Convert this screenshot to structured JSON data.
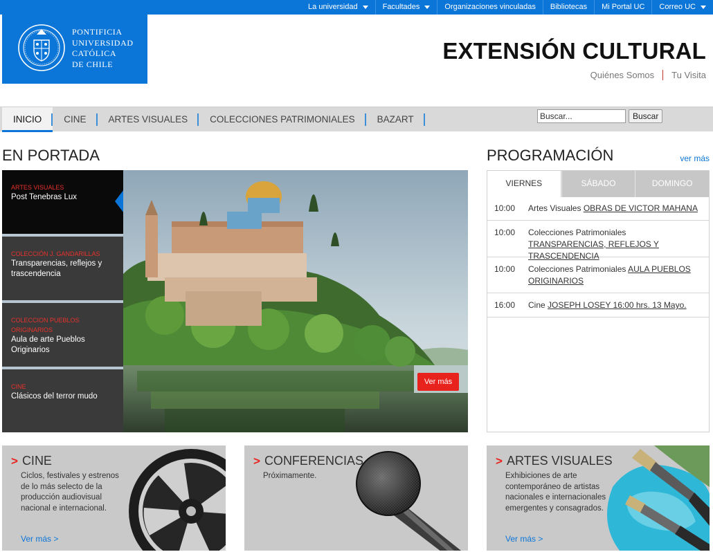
{
  "topnav": [
    {
      "label": "La universidad",
      "dropdown": true
    },
    {
      "label": "Facultades",
      "dropdown": true
    },
    {
      "label": "Organizaciones vinculadas",
      "dropdown": false
    },
    {
      "label": "Bibliotecas",
      "dropdown": false
    },
    {
      "label": "Mi Portal UC",
      "dropdown": false
    },
    {
      "label": "Correo UC",
      "dropdown": true
    }
  ],
  "logo": {
    "lines": [
      "PONTIFICIA",
      "UNIVERSIDAD",
      "CATÓLICA",
      "DE CHILE"
    ],
    "seal_icon": "university-seal-icon"
  },
  "header": {
    "title": "EXTENSIÓN CULTURAL",
    "links": [
      "Quiénes Somos",
      "Tu Visita"
    ]
  },
  "mainnav": {
    "items": [
      "INICIO",
      "CINE",
      "ARTES VISUALES",
      "COLECCIONES PATRIMONIALES",
      "BAZART"
    ],
    "active": "INICIO",
    "search_placeholder": "Buscar...",
    "search_button": "Buscar"
  },
  "portada": {
    "heading": "EN PORTADA",
    "items": [
      {
        "category": "ARTES VISUALES",
        "title": "Post Tenebras Lux"
      },
      {
        "category": "COLECCIÓN J. GANDARILLAS",
        "title": "Transparencias, reflejos y trascendencia"
      },
      {
        "category": "COLECCION PUEBLOS ORIGINARIOS",
        "title": "Aula de arte Pueblos Originarios"
      },
      {
        "category": "CINE",
        "title": "Clásicos del terror mudo"
      }
    ],
    "button": "Ver más"
  },
  "programacion": {
    "heading": "PROGRAMACIÓN",
    "ver_mas": "ver más",
    "tabs": [
      "VIERNES",
      "SÁBADO",
      "DOMINGO"
    ],
    "active_tab": "VIERNES",
    "events": [
      {
        "time": "10:00",
        "type": "Artes Visuales",
        "link": "OBRAS DE VICTOR MAHANA"
      },
      {
        "time": "10:00",
        "type": "Colecciones Patrimoniales",
        "link": "TRANSPARENCIAS, REFLEJOS Y TRASCENDENCIA"
      },
      {
        "time": "10:00",
        "type": "Colecciones Patrimoniales",
        "link": "AULA PUEBLOS ORIGINARIOS"
      },
      {
        "time": "16:00",
        "type": "Cine",
        "link": "JOSEPH LOSEY 16:00 hrs. 13 Mayo."
      }
    ]
  },
  "cards": [
    {
      "title": "CINE",
      "desc": "Ciclos, festivales y estrenos de lo más selecto de la producción audiovisual nacional e internacional.",
      "link": "Ver más >",
      "icon": "film-reel-icon"
    },
    {
      "title": "CONFERENCIAS",
      "desc": "Próximamente.",
      "link": "",
      "icon": "microphone-icon"
    },
    {
      "title": "ARTES VISUALES",
      "desc": "Exhibiciones de arte contemporáneo de artistas nacionales e internacionales emergentes y consagrados.",
      "link": "Ver más >",
      "icon": "paintbrushes-icon"
    }
  ],
  "colors": {
    "brand_blue": "#0b76d8",
    "accent_red": "#e8221d",
    "nav_grey": "#d9d9d9"
  }
}
